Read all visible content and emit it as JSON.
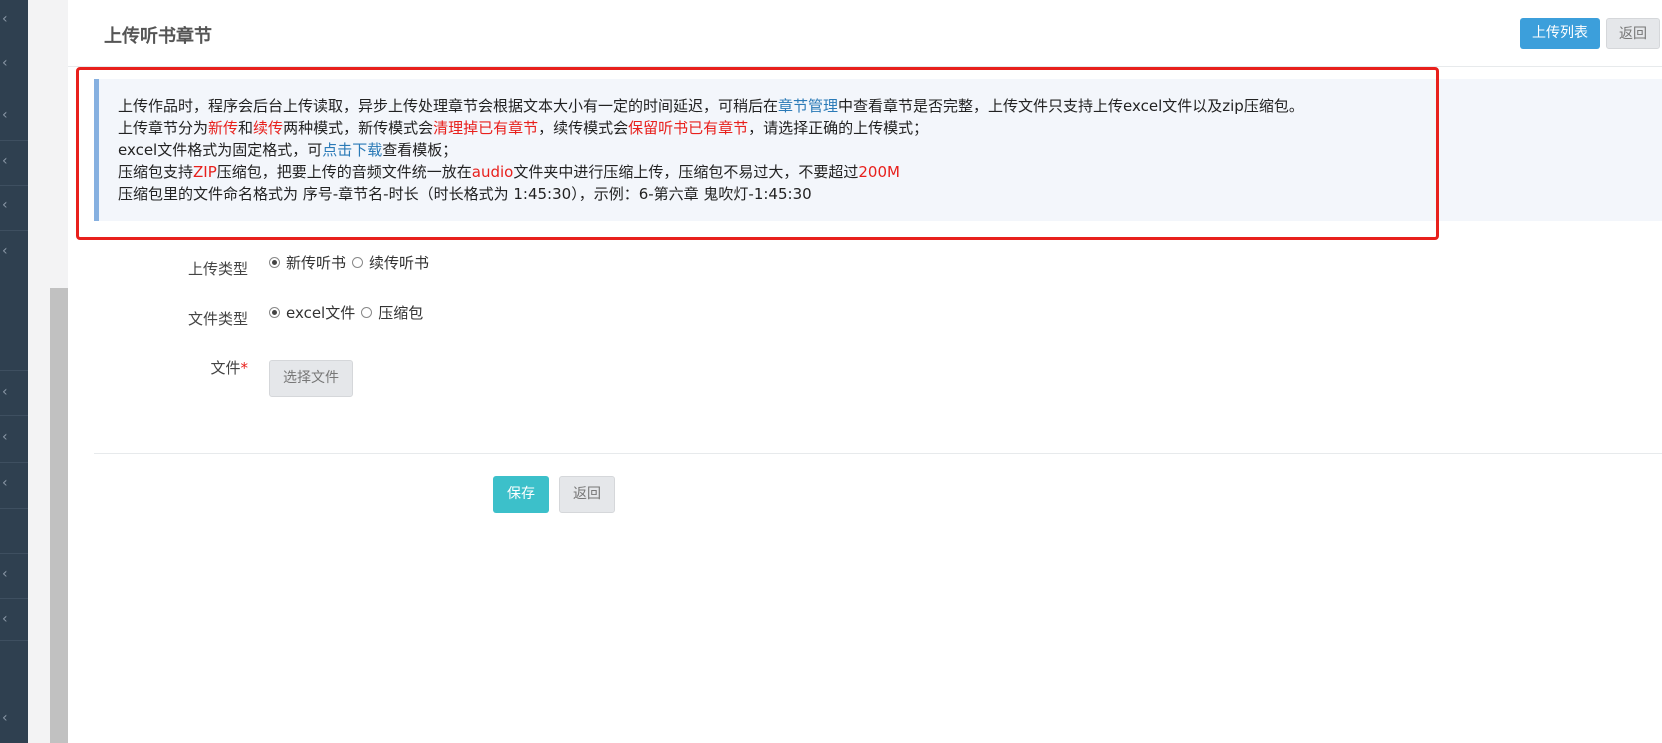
{
  "nav": {
    "chevron_glyph": "‹",
    "chevron_count": 13
  },
  "header": {
    "title": "上传听书章节",
    "upload_list_label": "上传列表",
    "back_label": "返回"
  },
  "notice": {
    "line1": {
      "a": "上传作品时，程序会后台上传读取，异步上传处理章节会根据文本大小有一定的时间延迟，可稍后在",
      "link": "章节管理",
      "b": "中查看章节是否完整，上传文件只支持上传excel文件以及zip压缩包。"
    },
    "line2": {
      "a": "上传章节分为",
      "new": "新传",
      "and": "和",
      "cont": "续传",
      "b": "两种模式，新传模式会",
      "clear": "清理掉已有章节",
      "c": "，续传模式会",
      "keep": "保留听书已有章节",
      "d": "，请选择正确的上传模式；"
    },
    "line3": {
      "a": "excel文件格式为固定格式，可",
      "link": "点击下载",
      "b": "查看模板；"
    },
    "line4": {
      "a": "压缩包支持",
      "zip": "ZIP",
      "b": "压缩包，把要上传的音频文件统一放在",
      "audio": "audio",
      "c": "文件夹中进行压缩上传，压缩包不易过大，不要超过",
      "size": "200M"
    },
    "line5": "压缩包里的文件命名格式为 序号-章节名-时长（时长格式为 1:45:30），示例：6-第六章 鬼吹灯-1:45:30"
  },
  "form": {
    "upload_type": {
      "label": "上传类型",
      "options": [
        "新传听书",
        "续传听书"
      ],
      "selected": "新传听书"
    },
    "file_type": {
      "label": "文件类型",
      "options": [
        "excel文件",
        "压缩包"
      ],
      "selected": "excel文件"
    },
    "file": {
      "label": "文件",
      "required_mark": "*",
      "choose_label": "选择文件"
    }
  },
  "actions": {
    "save_label": "保存",
    "back_label": "返回"
  },
  "colors": {
    "nav_bg": "#2f4050",
    "primary_blue": "#3c9fdb",
    "save_teal": "#3cc0ca",
    "warning_red": "#e8201c",
    "link_blue": "#2a7ab7",
    "notice_bg": "#f3f6fb"
  }
}
